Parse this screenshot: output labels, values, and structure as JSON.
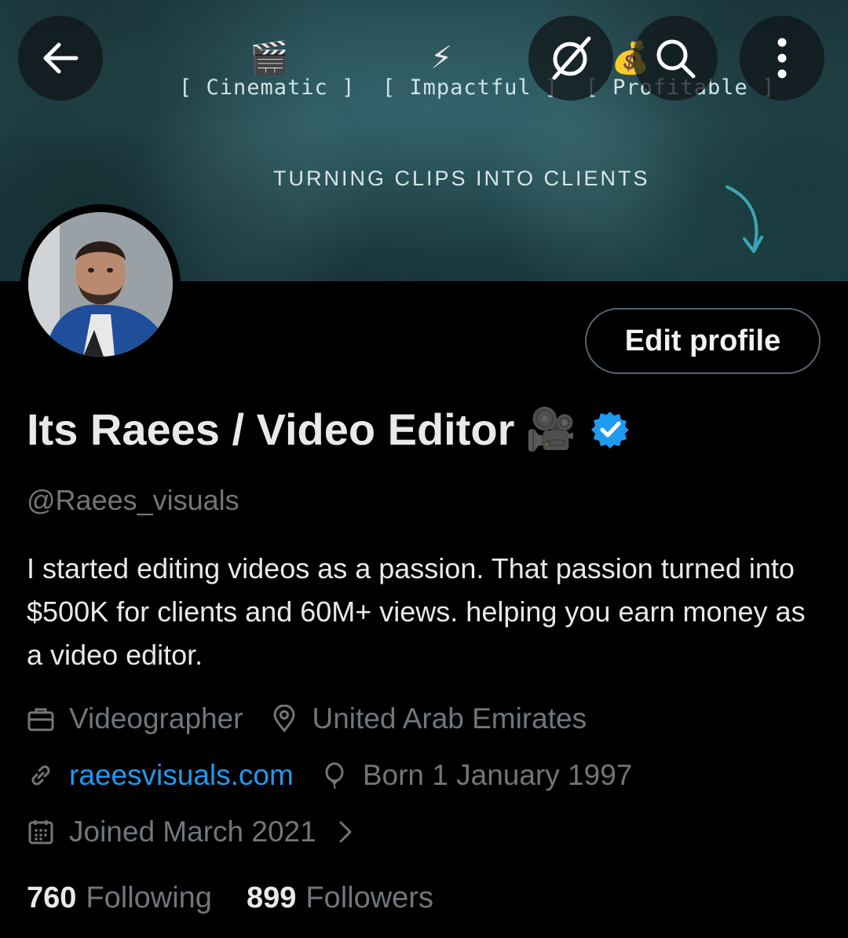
{
  "banner": {
    "emojis": [
      "🎬",
      "⚡",
      "💰"
    ],
    "tags": "[ Cinematic ]  [ Impactful ]  [ Profitable ]",
    "tagline": "TURNING CLIPS INTO CLIENTS"
  },
  "toolbar": {
    "back_icon": "arrow-left-icon",
    "grok_icon": "grok-icon",
    "search_icon": "search-icon",
    "more_icon": "more-vertical-icon"
  },
  "profile": {
    "edit_label": "Edit profile",
    "display_name": "Its Raees / Video Editor",
    "name_emoji": "🎥",
    "verified_color": "#1d9bf0",
    "handle": "@Raees_visuals",
    "bio": "I started editing videos as a passion. That passion turned into $500K for clients and 60M+ views. helping you earn money as a video editor.",
    "profession": "Videographer",
    "location": "United Arab Emirates",
    "website": "raeesvisuals.com",
    "birthday": "Born 1 January 1997",
    "joined": "Joined March 2021"
  },
  "stats": {
    "following_count": "760",
    "following_label": "Following",
    "followers_count": "899",
    "followers_label": "Followers"
  },
  "colors": {
    "accent": "#1d9bf0",
    "muted": "#71767b",
    "text": "#e7e9ea",
    "background": "#000000"
  }
}
